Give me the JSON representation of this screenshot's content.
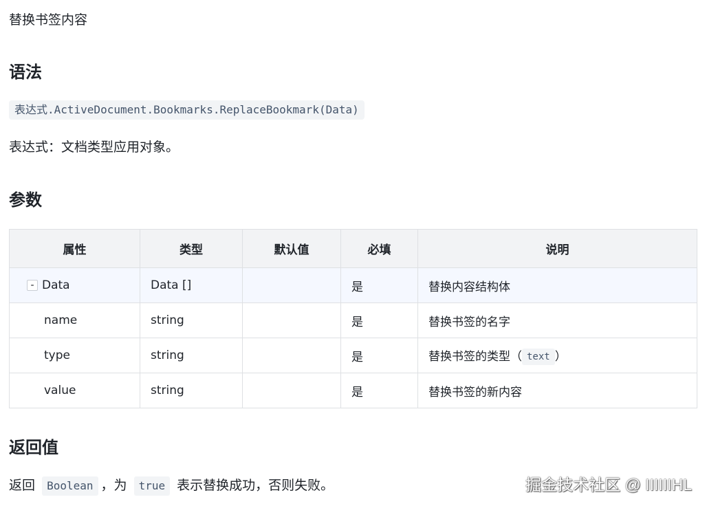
{
  "intro": "替换书签内容",
  "syntax": {
    "heading": "语法",
    "code": "表达式.ActiveDocument.Bookmarks.ReplaceBookmark(Data)",
    "description": "表达式：文档类型应用对象。"
  },
  "params": {
    "heading": "参数",
    "columns": [
      "属性",
      "类型",
      "默认值",
      "必填",
      "说明"
    ],
    "rows": [
      {
        "toggle": "-",
        "name": "Data",
        "type": "Data []",
        "default": "",
        "required": "是",
        "desc": "替换内容结构体",
        "desc_code": "",
        "desc_suffix": ""
      },
      {
        "name": "name",
        "type": "string",
        "default": "",
        "required": "是",
        "desc": "替换书签的名字",
        "desc_code": "",
        "desc_suffix": ""
      },
      {
        "name": "type",
        "type": "string",
        "default": "",
        "required": "是",
        "desc": "替换书签的类型（",
        "desc_code": "text",
        "desc_suffix": "）"
      },
      {
        "name": "value",
        "type": "string",
        "default": "",
        "required": "是",
        "desc": "替换书签的新内容",
        "desc_code": "",
        "desc_suffix": ""
      }
    ]
  },
  "returns": {
    "heading": "返回值",
    "prefix": "返回",
    "type_code": "Boolean",
    "middle": "，为",
    "value_code": "true",
    "suffix": "表示替换成功，否则失败。"
  },
  "watermark": "掘金技术社区 @ IIIIIIHL"
}
